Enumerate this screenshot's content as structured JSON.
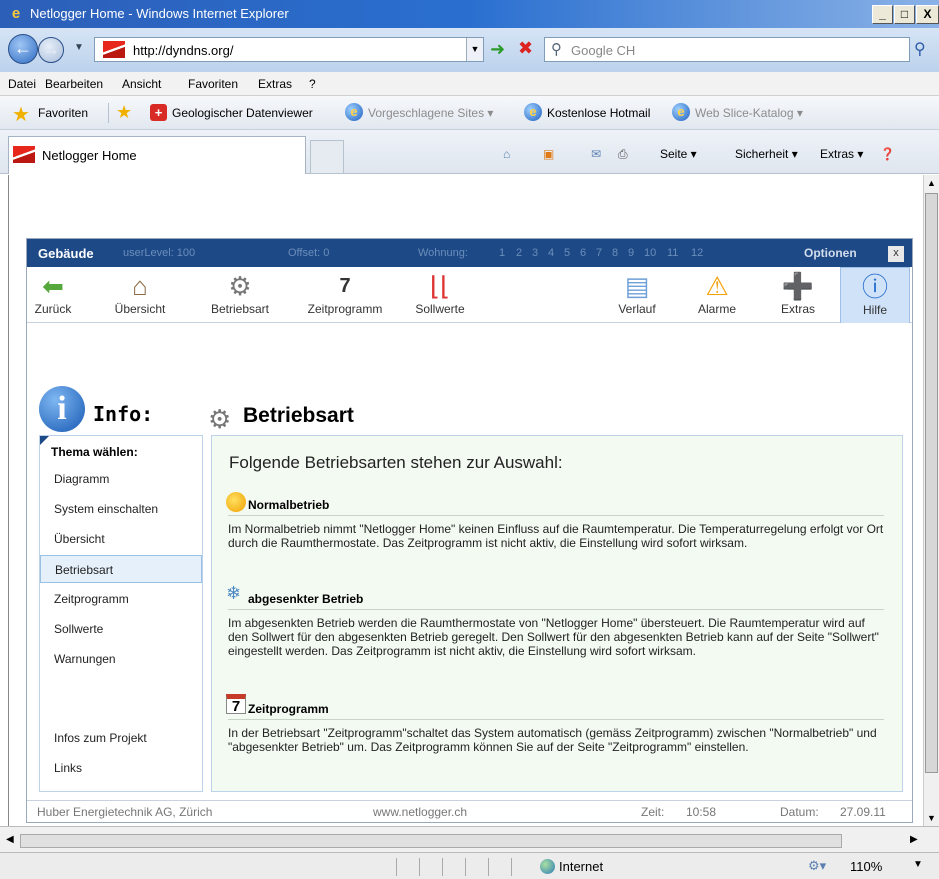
{
  "window": {
    "title": "Netlogger Home - Windows Internet Explorer",
    "min": "_",
    "max": "□",
    "close": "X"
  },
  "address": {
    "url": "http://dyndns.org/",
    "search_placeholder": "Google CH"
  },
  "menu": [
    "Datei",
    "Bearbeiten",
    "Ansicht",
    "Favoriten",
    "Extras",
    "?"
  ],
  "favorites": {
    "label": "Favoriten",
    "items": [
      "Geologischer Datenviewer",
      "Vorgeschlagene Sites ▾",
      "Kostenlose Hotmail",
      "Web Slice-Katalog ▾"
    ]
  },
  "tab": {
    "label": "Netlogger Home"
  },
  "commands": [
    "Seite ▾",
    "Sicherheit ▾",
    "Extras ▾"
  ],
  "app": {
    "header": {
      "title": "Gebäude",
      "user_level": "userLevel: 100",
      "offset": "Offset: 0",
      "wohnung_label": "Wohnung:",
      "wohnungen": [
        "1",
        "2",
        "3",
        "4",
        "5",
        "6",
        "7",
        "8",
        "9",
        "10",
        "11",
        "12"
      ],
      "options": "Optionen",
      "close": "x"
    },
    "toolbar": [
      {
        "label": "Zurück",
        "icon": "back-arrow-icon"
      },
      {
        "label": "Übersicht",
        "icon": "house-icon"
      },
      {
        "label": "Betriebsart",
        "icon": "gear-icon"
      },
      {
        "label": "Zeitprogramm",
        "icon": "calendar-icon"
      },
      {
        "label": "Sollwerte",
        "icon": "thermometer-icon"
      },
      {
        "label": "Verlauf",
        "icon": "chart-icon"
      },
      {
        "label": "Alarme",
        "icon": "warning-icon"
      },
      {
        "label": "Extras",
        "icon": "plus-icon"
      },
      {
        "label": "Hilfe",
        "icon": "info-icon"
      }
    ],
    "info_title": "Info:",
    "section_title": "Betriebsart",
    "sidebar": {
      "heading": "Thema wählen:",
      "items": [
        "Diagramm",
        "System einschalten",
        "Übersicht",
        "Betriebsart",
        "Zeitprogramm",
        "Sollwerte",
        "Warnungen"
      ],
      "bottom_items": [
        "Infos zum Projekt",
        "Links"
      ],
      "active": "Betriebsart"
    },
    "content": {
      "lead": "Folgende Betriebsarten stehen zur Auswahl:",
      "sections": [
        {
          "title": "Normalbetrieb",
          "icon": "sun-thermometer-icon",
          "text": "Im Normalbetrieb nimmt \"Netlogger Home\" keinen Einfluss auf die Raumtemperatur. Die Temperaturregelung erfolgt vor Ort durch die Raumthermostate. Das Zeitprogramm ist nicht aktiv, die Einstellung wird sofort wirksam."
        },
        {
          "title": "abgesenkter Betrieb",
          "icon": "snowflake-icon",
          "text": "Im abgesenkten Betrieb werden die Raumthermostate von \"Netlogger Home\" übersteuert. Die Raumtemperatur wird auf den Sollwert für den abgesenkten Betrieb geregelt. Den Sollwert für den abgesenkten Betrieb kann auf der Seite \"Sollwert\" eingestellt werden. Das Zeitprogramm ist nicht aktiv, die Einstellung wird sofort wirksam."
        },
        {
          "title": "Zeitprogramm",
          "icon": "calendar-icon",
          "text": "In der Betriebsart \"Zeitprogramm\"schaltet das System automatisch (gemäss Zeitprogramm) zwischen \"Normalbetrieb\" und \"abgesenkter Betrieb\" um. Das Zeitprogramm können Sie auf der Seite \"Zeitprogramm\" einstellen."
        }
      ]
    },
    "footer": {
      "company": "Huber Energietechnik AG, Zürich",
      "website": "www.netlogger.ch",
      "time_label": "Zeit:",
      "time": "10:58",
      "date_label": "Datum:",
      "date": "27.09.11"
    }
  },
  "status": {
    "zone": "Internet",
    "zoom": "110%"
  }
}
